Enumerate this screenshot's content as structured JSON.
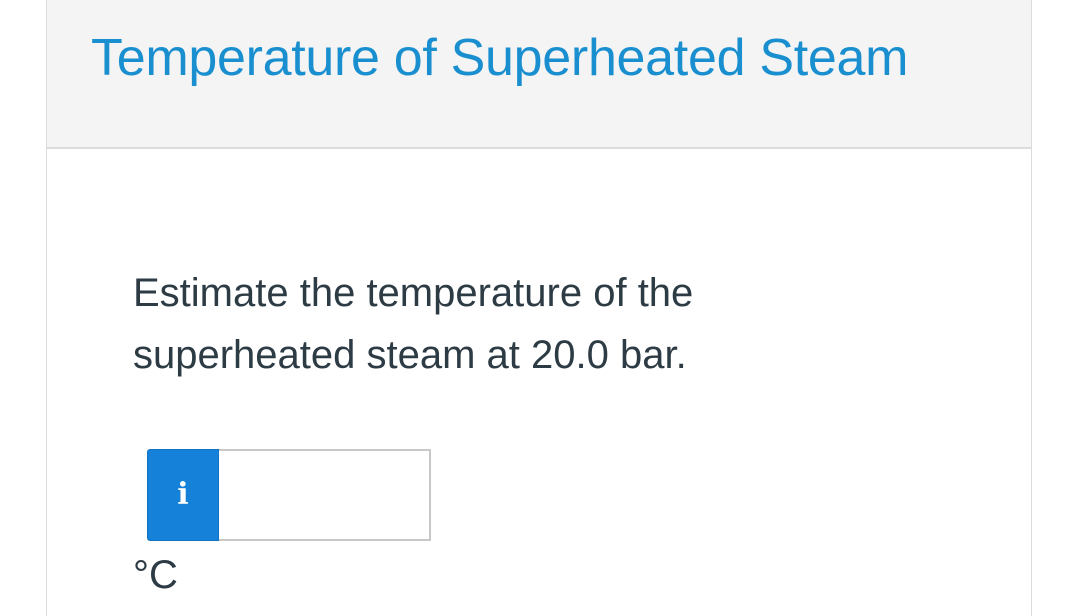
{
  "header": {
    "title": "Temperature of Superheated Steam"
  },
  "question": {
    "text_line1": "Estimate the temperature of the",
    "text_line2": "superheated steam at 20.0 bar."
  },
  "answer": {
    "info_icon": "info-icon",
    "info_glyph": "i",
    "value": "",
    "unit": "°C"
  },
  "colors": {
    "title": "#1a8fd0",
    "info_button": "#1581d8",
    "text": "#2d3b45",
    "header_bg": "#f4f4f4"
  }
}
